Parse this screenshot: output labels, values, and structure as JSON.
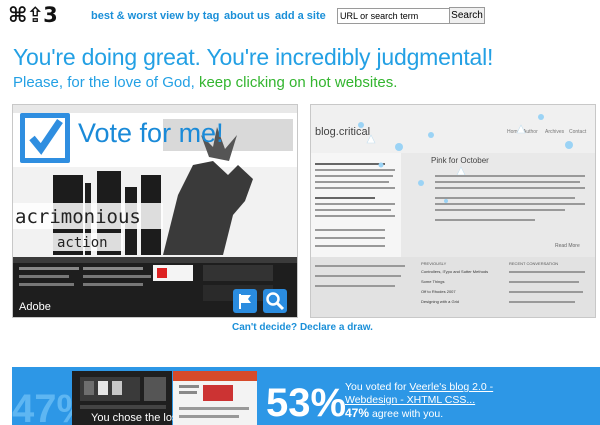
{
  "header": {
    "logo": "⌘⇪3",
    "nav": [
      "best & worst",
      "view by tag",
      "about us",
      "add a site"
    ],
    "search_value": "URL or search term",
    "search_button": "Search"
  },
  "headline": "You're doing great. You're incredibly judgmental!",
  "subline": {
    "lead": "Please, for the love of God, ",
    "link": "keep clicking on hot websites."
  },
  "left_card": {
    "vote_text": "Vote for me!",
    "site_name": "Adobe",
    "art_text_1": "acrimonious",
    "art_text_2": "action"
  },
  "right_card": {
    "site_title": "blog.critical",
    "tabs": [
      "Home",
      "Author",
      "Archives",
      "Contact"
    ],
    "post_title": "Pink for October",
    "read_more": "Read More",
    "footer_heads": [
      "PREVIOUSLY",
      "RECENT CONVERSATION"
    ],
    "footer_items": [
      "Controllers, iTypo and Sutter Methods",
      "Some Things",
      "Off to Rhodes 2007",
      "Designing with a Grid"
    ]
  },
  "draw_link": "Can't decide? Declare a draw.",
  "result": {
    "left_pct": "47%",
    "right_pct": "53%",
    "loser_text": "You chose the loser.",
    "voted_prefix": "You voted for ",
    "voted_site": "Veerle's blog 2.0 - Webdesign - XHTML CSS...",
    "agree_pct": "47%",
    "agree_suffix": " agree with you."
  },
  "colors": {
    "accent": "#23a0e4",
    "green": "#33b52f",
    "result_bar": "#2d97e6"
  }
}
